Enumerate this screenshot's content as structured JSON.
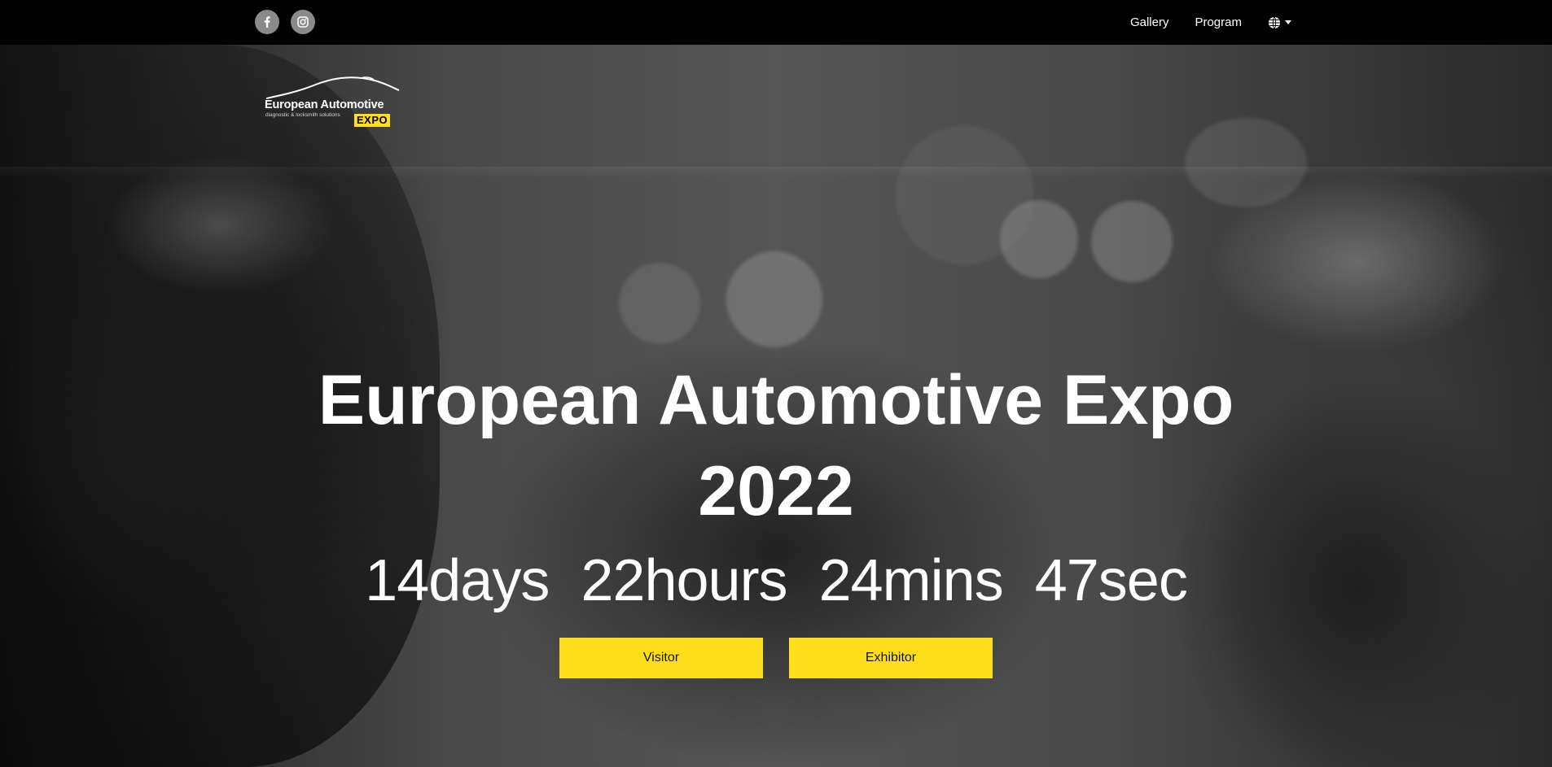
{
  "topbar": {
    "social": [
      {
        "name": "facebook",
        "icon": "facebook-icon"
      },
      {
        "name": "instagram",
        "icon": "instagram-icon"
      }
    ],
    "nav": {
      "gallery_label": "Gallery",
      "program_label": "Program",
      "language_icon": "globe-icon"
    }
  },
  "logo": {
    "title": "European Automotive",
    "subtitle": "diagnostic & locksmith solutions",
    "badge": "EXPO"
  },
  "hero": {
    "title_line1": "European Automotive Expo",
    "title_line2": "2022",
    "countdown": {
      "days": "14",
      "days_unit": "days",
      "hours": "22",
      "hours_unit": "hours",
      "mins": "24",
      "mins_unit": "mins",
      "sec": "47",
      "sec_unit": "sec"
    },
    "buttons": {
      "visitor_label": "Visitor",
      "exhibitor_label": "Exhibitor"
    }
  },
  "colors": {
    "accent": "#ffdf1b",
    "topbar_bg": "#000000",
    "social_btn_bg": "#8a8a8a",
    "text": "#ffffff"
  }
}
